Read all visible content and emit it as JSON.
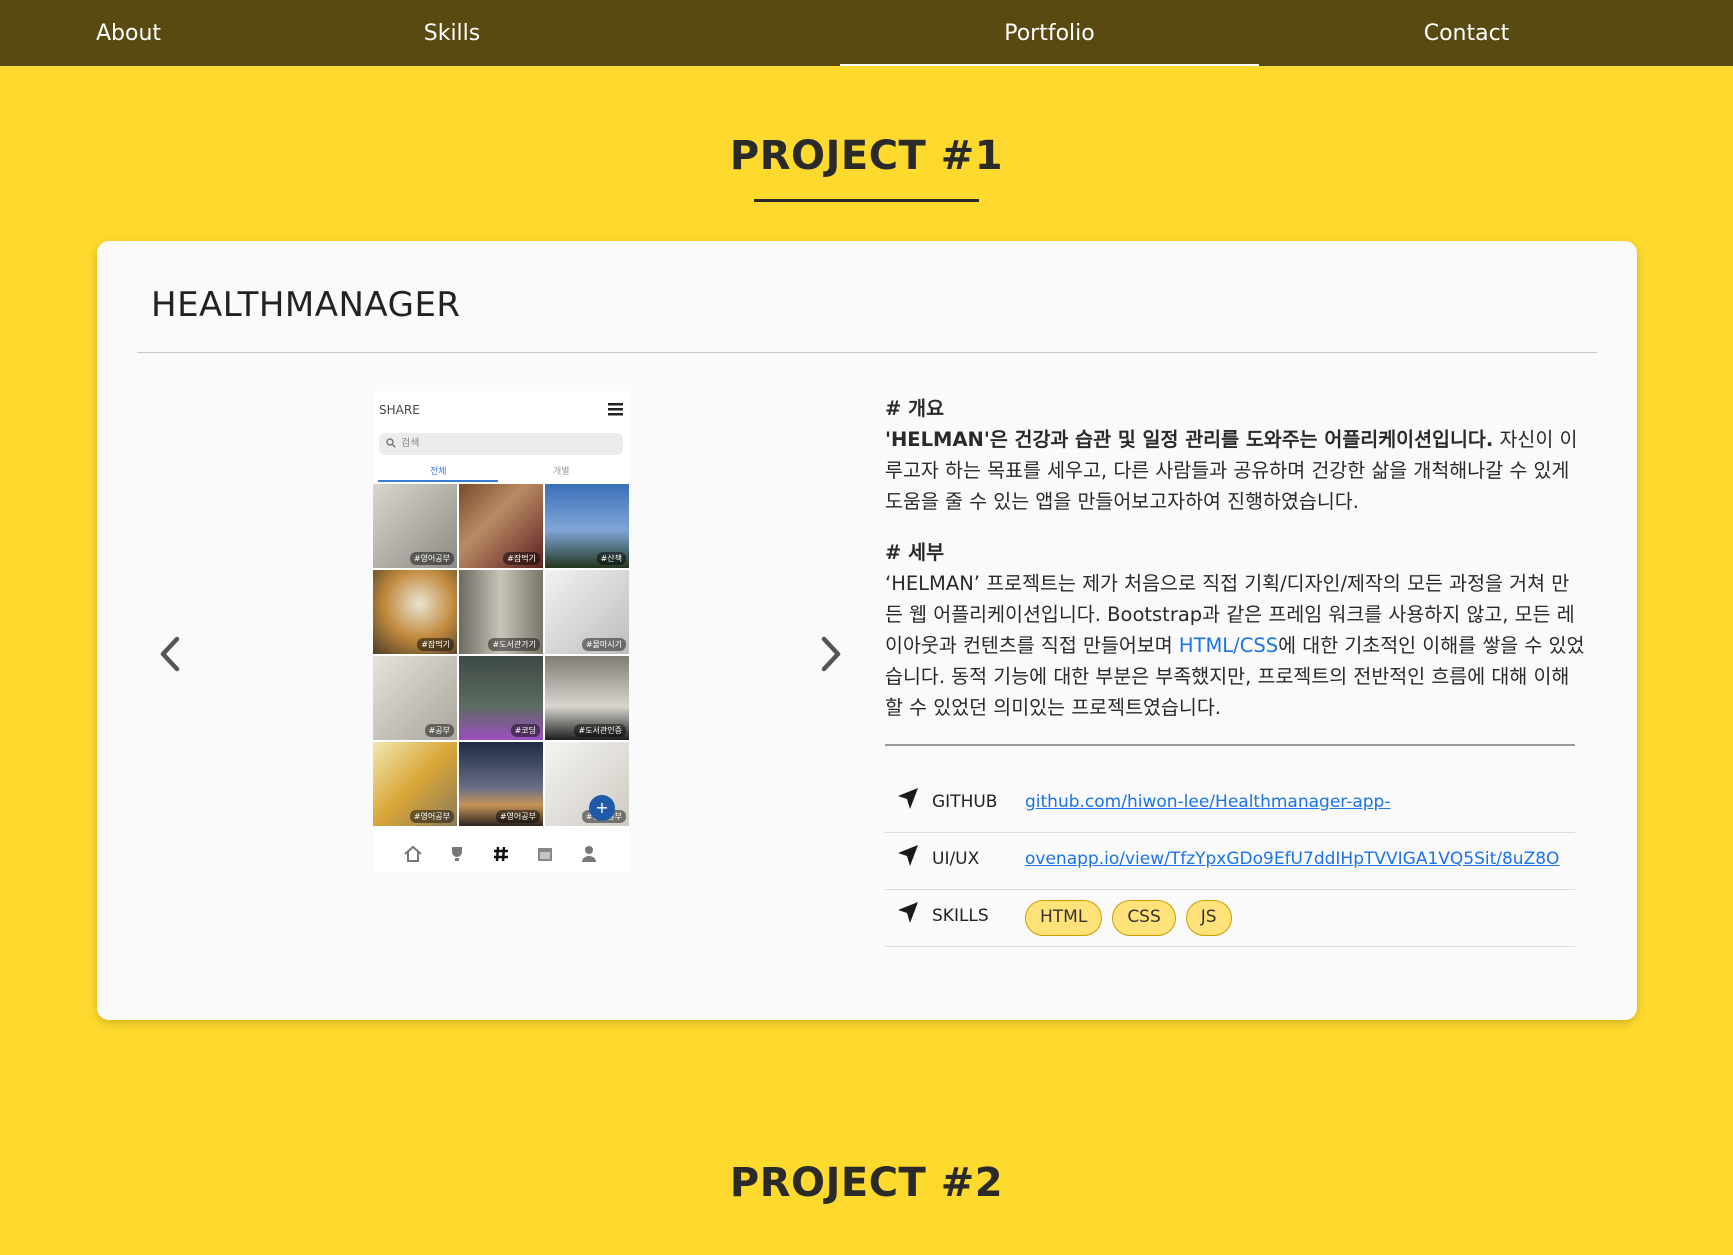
{
  "nav": {
    "items": [
      {
        "label": "About"
      },
      {
        "label": "Skills"
      },
      {
        "label": "Portfolio"
      },
      {
        "label": "Contact"
      }
    ],
    "active": "Portfolio"
  },
  "project1": {
    "heading": "PROJECT #1",
    "title": "HEALTHMANAGER",
    "carousel": {
      "prev_icon": "chevron-left-icon",
      "next_icon": "chevron-right-icon",
      "screenshot": {
        "header": "SHARE",
        "search_placeholder": "검색",
        "tabs": [
          "전체",
          "개별"
        ],
        "tags": [
          "#영어공부",
          "#잠먹기",
          "#산책",
          "#잠먹기",
          "#도서관가기",
          "#물마시기",
          "#공부",
          "#코딩",
          "#도서관인증",
          "#영어공부",
          "#영어공부",
          "#영어공부"
        ],
        "fab": "+"
      }
    },
    "overview_heading": "# 개요",
    "overview_bold": "'HELMAN'은 건강과 습관 및 일정 관리를 도와주는 어플리케이션입니다.",
    "overview_text": " 자신이 이루고자 하는 목표를 세우고, 다른 사람들과 공유하며 건강한 삶을 개척해나갈 수 있게 도움을 줄 수 있는 앱을 만들어보고자하여 진행하였습니다.",
    "detail_heading": "# 세부",
    "detail_text_1": "‘HELMAN’ 프로젝트는 제가 처음으로 직접 기획/디자인/제작의 모든 과정을 거쳐 만든 웹 어플리케이션입니다. Bootstrap과 같은 프레임 워크를 사용하지 않고, 모든 레이아웃과 컨텐츠를 직접 만들어보며 ",
    "detail_link": "HTML/CSS",
    "detail_text_2": "에 대한 기초적인 이해를 쌓을 수 있었습니다. 동적 기능에 대한 부분은 부족했지만, 프로젝트의 전반적인 흐름에 대해 이해할 수 있었던 의미있는 프로젝트였습니다.",
    "info": {
      "github_label": "GITHUB",
      "github_link": "github.com/hiwon-lee/Healthmanager-app-",
      "uiux_label": "UI/UX",
      "uiux_link": "ovenapp.io/view/TfzYpxGDo9EfU7ddIHpTVVIGA1VQ5Sit/8uZ8O",
      "skills_label": "SKILLS",
      "skills": [
        "HTML",
        "CSS",
        "JS"
      ],
      "row_icon": "navigation-arrow-icon"
    }
  },
  "project2": {
    "heading": "PROJECT #2"
  },
  "colors": {
    "background": "#FFDA2E",
    "nav": "#594A12",
    "link": "#1a73e8",
    "badge": "#FFE27A"
  }
}
